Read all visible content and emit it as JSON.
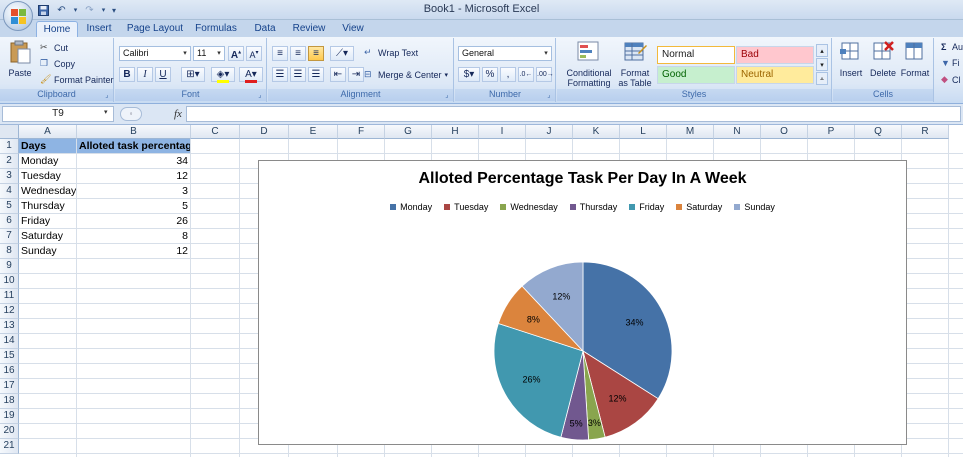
{
  "window": {
    "title": "Book1 - Microsoft Excel"
  },
  "tabs": [
    "Home",
    "Insert",
    "Page Layout",
    "Formulas",
    "Data",
    "Review",
    "View"
  ],
  "ribbon": {
    "clipboard": {
      "label": "Clipboard",
      "paste": "Paste",
      "cut": "Cut",
      "copy": "Copy",
      "format_painter": "Format Painter"
    },
    "font": {
      "label": "Font",
      "name": "Calibri",
      "size": "11"
    },
    "alignment": {
      "label": "Alignment",
      "wrap_text": "Wrap Text",
      "merge_center": "Merge & Center"
    },
    "number": {
      "label": "Number",
      "format": "General"
    },
    "styles": {
      "label": "Styles",
      "conditional_formatting": "Conditional Formatting",
      "format_as_table": "Format as Table",
      "normal": "Normal",
      "bad": "Bad",
      "good": "Good",
      "neutral": "Neutral"
    },
    "cells": {
      "label": "Cells",
      "insert": "Insert",
      "delete": "Delete",
      "format": "Format"
    },
    "editing": {
      "autosum_partial": "Au",
      "fill_partial": "Fi",
      "clear_partial": "Cl"
    }
  },
  "formula_bar": {
    "name_box": "T9",
    "fx": "fx",
    "formula": ""
  },
  "columns": [
    "A",
    "B",
    "C",
    "D",
    "E",
    "F",
    "G",
    "H",
    "I",
    "J",
    "K",
    "L",
    "M",
    "N",
    "O",
    "P",
    "Q",
    "R"
  ],
  "rows": [
    "1",
    "2",
    "3",
    "4",
    "5",
    "6",
    "7",
    "8",
    "9",
    "10",
    "11",
    "12",
    "13",
    "14",
    "15",
    "16",
    "17",
    "18",
    "19",
    "20",
    "21"
  ],
  "sheet": {
    "header": [
      "Days",
      "Alloted task percentage"
    ],
    "data": [
      [
        "Monday",
        "34"
      ],
      [
        "Tuesday",
        "12"
      ],
      [
        "Wednesday",
        "3"
      ],
      [
        "Thursday",
        "5"
      ],
      [
        "Friday",
        "26"
      ],
      [
        "Saturday",
        "8"
      ],
      [
        "Sunday",
        "12"
      ]
    ]
  },
  "chart_data": {
    "type": "pie",
    "title": "Alloted Percentage Task Per Day In A Week",
    "categories": [
      "Monday",
      "Tuesday",
      "Wednesday",
      "Thursday",
      "Friday",
      "Saturday",
      "Sunday"
    ],
    "values": [
      34,
      12,
      3,
      5,
      26,
      8,
      12
    ],
    "labels": [
      "34%",
      "12%",
      "3%",
      "5%",
      "26%",
      "8%",
      "12%"
    ],
    "colors": [
      "#4572a7",
      "#aa4643",
      "#89a54e",
      "#71588f",
      "#4198af",
      "#db843d",
      "#93a9cf"
    ],
    "legend": "top"
  }
}
